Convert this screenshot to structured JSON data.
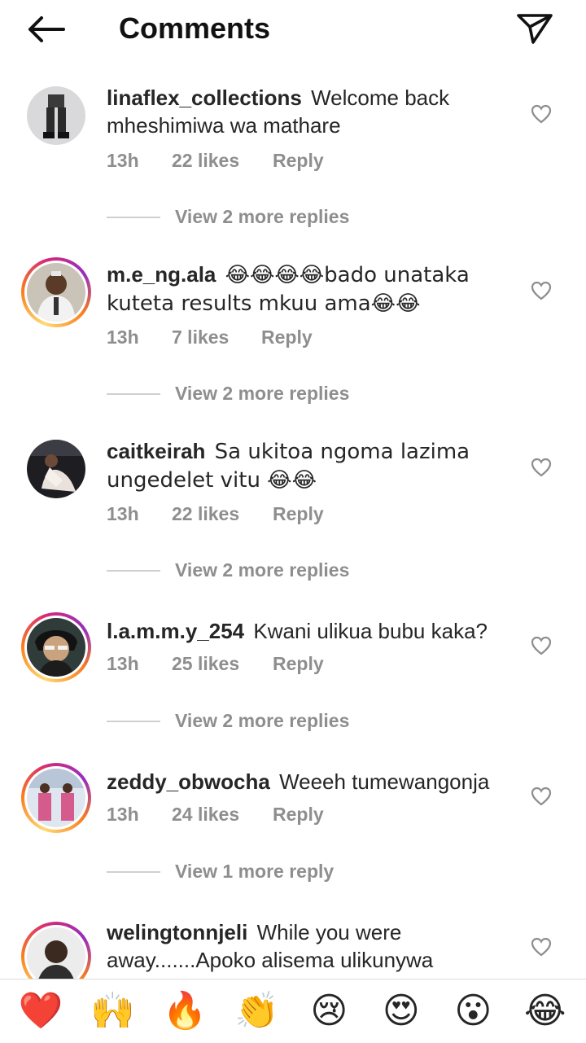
{
  "header": {
    "title": "Comments",
    "back_icon": "arrow-left-icon",
    "send_icon": "paper-plane-icon"
  },
  "comments": [
    {
      "username": "linaflex_collections",
      "text": "Welcome back mheshimiwa wa mathare",
      "time": "13h",
      "likes": "22 likes",
      "reply": "Reply",
      "view_replies": "View 2 more replies",
      "avatar_ring": false
    },
    {
      "username": "m.e_ng.ala",
      "text": "😂😂😂😂bado unataka kuteta results mkuu ama😂😂",
      "time": "13h",
      "likes": "7 likes",
      "reply": "Reply",
      "view_replies": "View 2 more replies",
      "avatar_ring": true
    },
    {
      "username": "caitkeirah",
      "text": "Sa ukitoa ngoma lazima ungedelet vitu 😂😂",
      "time": "13h",
      "likes": "22 likes",
      "reply": "Reply",
      "view_replies": "View 2 more replies",
      "avatar_ring": false
    },
    {
      "username": "l.a.m.m.y_254",
      "text": "Kwani ulikua bubu kaka?",
      "time": "13h",
      "likes": "25 likes",
      "reply": "Reply",
      "view_replies": "View 2 more replies",
      "avatar_ring": true
    },
    {
      "username": "zeddy_obwocha",
      "text": "Weeeh tumewangonja",
      "time": "13h",
      "likes": "24 likes",
      "reply": "Reply",
      "view_replies": "View 1 more reply",
      "avatar_ring": true
    },
    {
      "username": "welingtonnjeli",
      "text": "While you were away.......Apoko alisema ulikunywa",
      "avatar_ring": true
    }
  ],
  "reactions": [
    "❤️",
    "🙌",
    "🔥",
    "👏",
    "😢",
    "😍",
    "😮",
    "😂"
  ],
  "colors": {
    "text": "#262626",
    "muted": "#8e8e8e",
    "heart_red": "#ed4956",
    "ring_start": "#feda75",
    "ring_end": "#962fbf"
  }
}
